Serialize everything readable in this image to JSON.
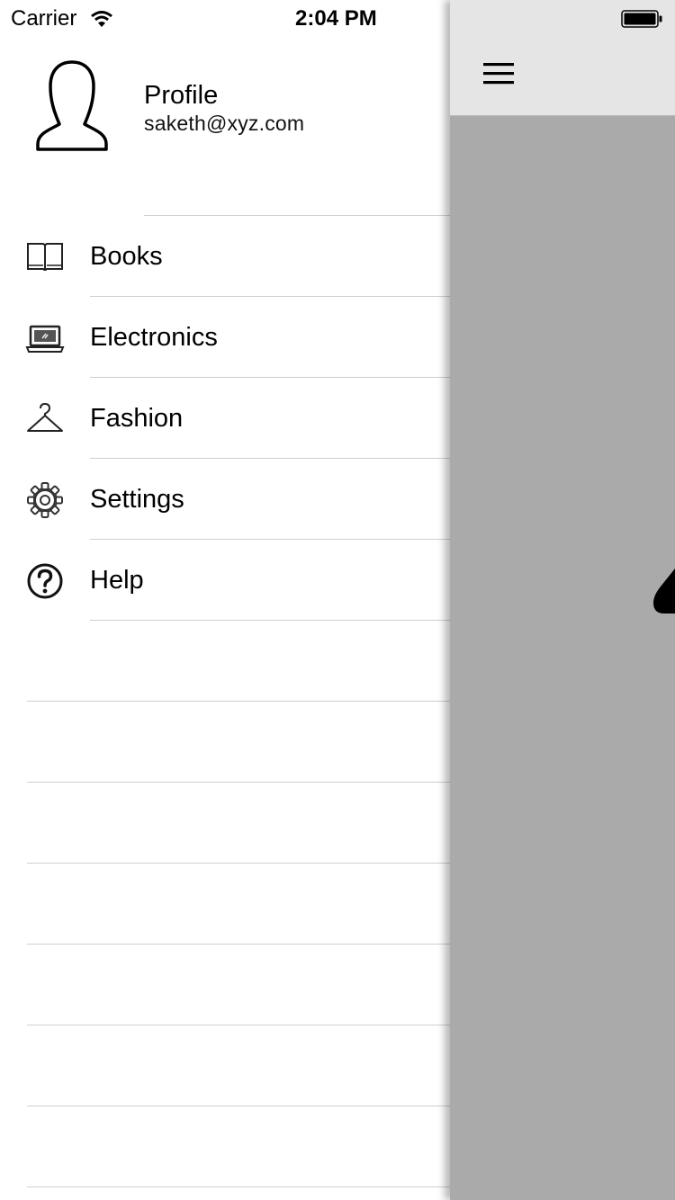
{
  "status_bar": {
    "carrier": "Carrier",
    "time": "2:04 PM"
  },
  "profile": {
    "name": "Profile",
    "email": "saketh@xyz.com",
    "avatar_icon": "user-outline-icon"
  },
  "menu": [
    {
      "label": "Books",
      "icon": "book-icon"
    },
    {
      "label": "Electronics",
      "icon": "laptop-icon"
    },
    {
      "label": "Fashion",
      "icon": "hanger-icon"
    },
    {
      "label": "Settings",
      "icon": "gear-icon"
    },
    {
      "label": "Help",
      "icon": "help-circle-icon"
    }
  ],
  "main": {
    "nav_icon": "hamburger-icon"
  },
  "colors": {
    "drawer_background": "#ffffff",
    "content_background": "#aaaaaa",
    "navbar_background": "#e5e5e5",
    "divider": "#cfcfcf"
  }
}
